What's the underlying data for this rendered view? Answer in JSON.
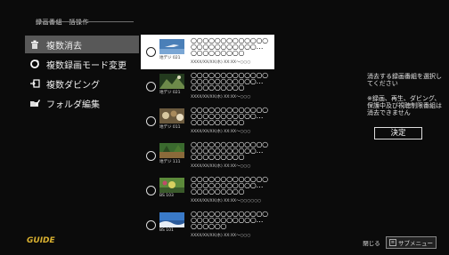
{
  "header": {
    "title": "録画番組一括操作"
  },
  "menu": {
    "items": [
      {
        "label": "複数消去",
        "icon": "trash-icon",
        "selected": true
      },
      {
        "label": "複数録画モード変更",
        "icon": "refresh-icon",
        "selected": false
      },
      {
        "label": "複数ダビング",
        "icon": "dubbing-icon",
        "selected": false
      },
      {
        "label": "フォルダ編集",
        "icon": "folder-edit-icon",
        "selected": false
      }
    ]
  },
  "recordings": [
    {
      "channel": "地デジ 021",
      "title": "○○○○○○○○○○○○○○○○○○○○○○○○…",
      "subtitle": "○○○○○○○○○",
      "datetime": "XXXX/XX/XX(水) XX:XX～○○○",
      "selected": true
    },
    {
      "channel": "地デジ 021",
      "title": "○○○○○○○○○○○○○○○○○○○○○○○○…",
      "subtitle": "○○○○○○○○○",
      "datetime": "XXXX/XX/XX(水) XX:XX～○○○",
      "selected": false
    },
    {
      "channel": "地デジ 011",
      "title": "○○○○○○○○○○○○○○○○○○○○○○○○…",
      "subtitle": "○○○○○○○○○",
      "datetime": "XXXX/XX/XX(水) XX:XX～○○○",
      "selected": false
    },
    {
      "channel": "地デジ 111",
      "title": "○○○○○○○○○○○○○○○○○○○○○○○○…",
      "subtitle": "○○○○○○○○○",
      "datetime": "XXXX/XX/XX(水) XX:XX～○○○",
      "selected": false
    },
    {
      "channel": "BS 103",
      "title": "○○○○○○○○○○○○○○○○○○○○○○○○…",
      "subtitle": "○○○○○○○○○",
      "datetime": "XXXX/XX/XX(水) XX:XX～○○○○○○",
      "selected": false
    },
    {
      "channel": "BS 101",
      "title": "○○○○○○○○○○○○○○○○○○○○○○○○…",
      "subtitle": "○○○○○○",
      "datetime": "XXXX/XX/XX(水) XX:XX～○○○",
      "selected": false
    }
  ],
  "info": {
    "instruction": "消去する録画番組を選択してください",
    "note": "※録画、再生、ダビング、保護中及び視聴制限番組は消去できません"
  },
  "decide_button": "決定",
  "footer": {
    "logo": "GUIDE",
    "close_label": "閉じる",
    "submenu_label": "サブメニュー",
    "submenu_key": "≡"
  },
  "colors": {
    "selected_menu_bg": "#585858",
    "selected_row_bg": "#ffffff",
    "background": "#0b0b0b",
    "logo": "#d8b030"
  }
}
